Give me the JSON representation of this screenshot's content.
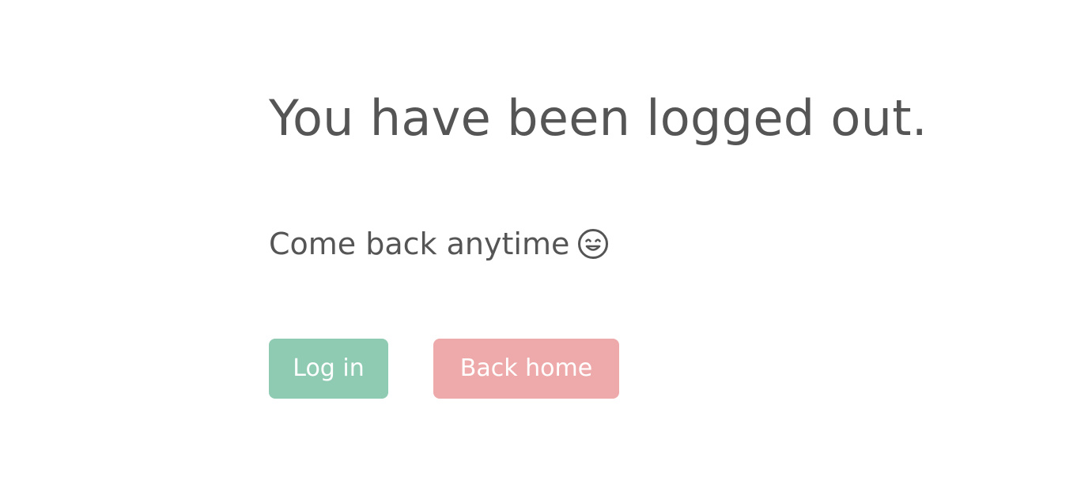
{
  "page": {
    "title": "You have been logged out.",
    "subtitle": "Come back anytime"
  },
  "actions": {
    "login_label": "Log in",
    "home_label": "Back home"
  },
  "icons": {
    "subtitle_icon": "smiling-face-icon"
  },
  "colors": {
    "text": "#555555",
    "login_button": "#8fcbb3",
    "home_button": "#eeaaaa",
    "button_text": "#ffffff",
    "background": "#ffffff"
  }
}
